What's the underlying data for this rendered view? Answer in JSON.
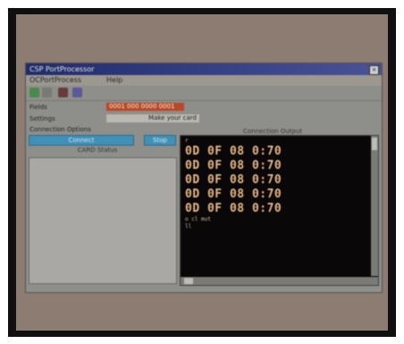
{
  "window": {
    "title": "CSP PortProcessor",
    "close_glyph": "×"
  },
  "menu": {
    "items": [
      "OCPortProcess",
      "Help"
    ]
  },
  "toolbar": {
    "icons": [
      "check-icon",
      "undo-icon",
      "settings-icon",
      "help-icon"
    ]
  },
  "form": {
    "fields": [
      {
        "label": "Fields",
        "value": "0001 000 0000 0001"
      },
      {
        "label": "Settings",
        "value": "Make your card"
      }
    ],
    "section_label": "Connection Options"
  },
  "buttons": {
    "connect": "Connect",
    "small": "Stop"
  },
  "left_panel": {
    "title": "CARD Status"
  },
  "right_panel": {
    "label": "Connection Output"
  },
  "terminal": {
    "lines": [
      "0D 0F 08 0:70",
      "0D 0F 08 0:70",
      "0D 0F 08 0:70",
      "0D 0F 08 0:70",
      "0D 0F 08 0:70"
    ],
    "top_marker": "r",
    "trailer": "o cl mut",
    "trailer2": "ll"
  },
  "colors": {
    "photo_background": "#8d7c72",
    "frame": "#101010",
    "terminal_bg": "#090707",
    "terminal_text": "#e8b888",
    "accent_button": "#4090b8",
    "field_highlight": "#b84828"
  }
}
